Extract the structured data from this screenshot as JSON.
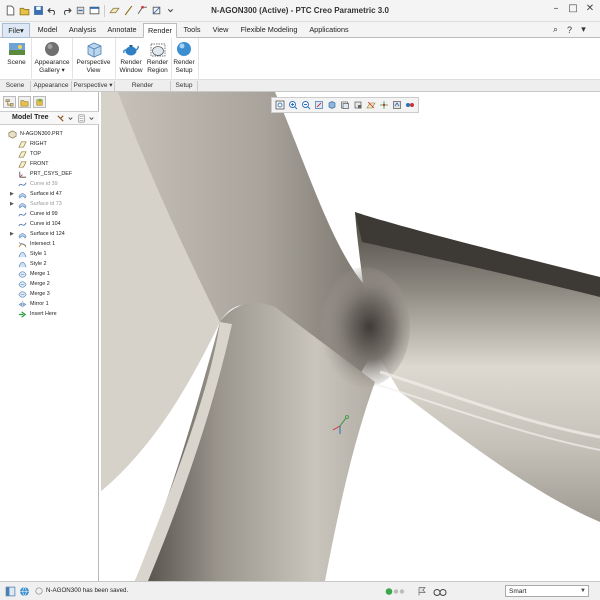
{
  "window": {
    "title": "N-AGON300 (Active) - PTC Creo Parametric 3.0"
  },
  "tabs": [
    {
      "label": "File",
      "state": "file"
    },
    {
      "label": "Model",
      "state": "normal"
    },
    {
      "label": "Analysis",
      "state": "normal"
    },
    {
      "label": "Annotate",
      "state": "normal"
    },
    {
      "label": "Render",
      "state": "active"
    },
    {
      "label": "Tools",
      "state": "normal"
    },
    {
      "label": "View",
      "state": "normal"
    },
    {
      "label": "Flexible Modeling",
      "state": "normal"
    },
    {
      "label": "Applications",
      "state": "normal"
    }
  ],
  "file_menu_arrow": "▾",
  "ribbon": {
    "scene": {
      "label": "Scene"
    },
    "appearance_gallery": {
      "label_line1": "Appearance",
      "label_line2": "Gallery ▾"
    },
    "perspective_view": {
      "label_line1": "Perspective",
      "label_line2": "View"
    },
    "render_window": {
      "label_line1": "Render",
      "label_line2": "Window"
    },
    "render_region": {
      "label_line1": "Render",
      "label_line2": "Region"
    },
    "render_setup": {
      "label_line1": "Render",
      "label_line2": "Setup"
    }
  },
  "ribbon_groups": [
    {
      "label": "Scene"
    },
    {
      "label": "Appearance"
    },
    {
      "label": "Perspective ▾"
    },
    {
      "label": "Render"
    },
    {
      "label": "Setup"
    }
  ],
  "model_tree": {
    "title": "Model Tree",
    "nodes": [
      {
        "label": "N-AGON300.PRT",
        "icon": "part-icon",
        "grey": false,
        "expander": false
      },
      {
        "label": "RIGHT",
        "icon": "datum-plane-icon",
        "grey": false,
        "expander": false
      },
      {
        "label": "TOP",
        "icon": "datum-plane-icon",
        "grey": false,
        "expander": false
      },
      {
        "label": "FRONT",
        "icon": "datum-plane-icon",
        "grey": false,
        "expander": false
      },
      {
        "label": "PRT_CSYS_DEF",
        "icon": "csys-icon",
        "grey": false,
        "expander": false
      },
      {
        "label": "Curve id 39",
        "icon": "curve-icon",
        "grey": true,
        "expander": false
      },
      {
        "label": "Surface id 47",
        "icon": "surface-icon",
        "grey": false,
        "expander": true
      },
      {
        "label": "Surface id 73",
        "icon": "surface-icon",
        "grey": true,
        "expander": true
      },
      {
        "label": "Curve id 99",
        "icon": "curve-icon",
        "grey": false,
        "expander": false
      },
      {
        "label": "Curve id 104",
        "icon": "curve-icon",
        "grey": false,
        "expander": false
      },
      {
        "label": "Surface id 124",
        "icon": "surface-icon",
        "grey": false,
        "expander": true
      },
      {
        "label": "Intersect 1",
        "icon": "intersect-icon",
        "grey": false,
        "expander": false
      },
      {
        "label": "Style 1",
        "icon": "style-icon",
        "grey": false,
        "expander": false
      },
      {
        "label": "Style 2",
        "icon": "style-icon",
        "grey": false,
        "expander": false
      },
      {
        "label": "Merge 1",
        "icon": "merge-icon",
        "grey": false,
        "expander": false
      },
      {
        "label": "Merge 2",
        "icon": "merge-icon",
        "grey": false,
        "expander": false
      },
      {
        "label": "Merge 3",
        "icon": "merge-icon",
        "grey": false,
        "expander": false
      },
      {
        "label": "Mirror 1",
        "icon": "mirror-icon",
        "grey": false,
        "expander": false
      },
      {
        "label": "Insert Here",
        "icon": "insert-here-icon",
        "grey": false,
        "expander": false
      }
    ]
  },
  "status": {
    "message": "N-AGON300 has been saved.",
    "filter_selected": "Smart"
  },
  "colors": {
    "accent": "#2a6ebb",
    "model_surface": "#bdb8b0",
    "model_shadow": "#56524c"
  }
}
